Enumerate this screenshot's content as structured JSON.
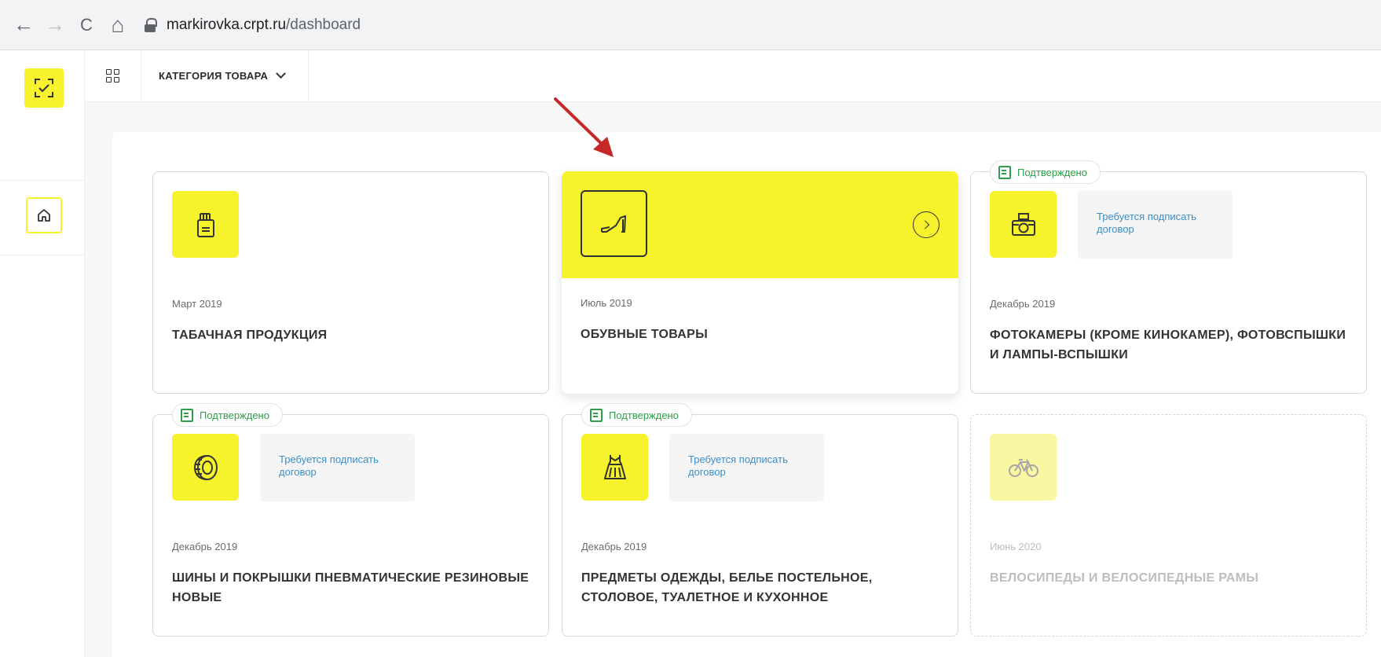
{
  "browser": {
    "url_host": "markirovka.crpt.ru",
    "url_path": "/dashboard",
    "back_glyph": "←",
    "forward_glyph": "→",
    "reload_glyph": "C",
    "home_glyph": "⌂"
  },
  "appbar": {
    "category_label": "КАТЕГОРИЯ ТОВАРА"
  },
  "colors": {
    "accent": "#f6f22b",
    "confirmed": "#2e9e4a",
    "link": "#3b8ec8",
    "arrow": "#c62828"
  },
  "cards": [
    {
      "date": "Март 2019",
      "title": "ТАБАЧНАЯ ПРОДУКЦИЯ",
      "icon": "cigarette-pack-icon"
    },
    {
      "date": "Июль 2019",
      "title": "ОБУВНЫЕ ТОВАРЫ",
      "icon": "shoe-icon",
      "highlighted": true
    },
    {
      "date": "Декабрь 2019",
      "title": "ФОТОКАМЕРЫ (КРОМЕ КИНОКАМЕР), ФОТОВСПЫШКИ И ЛАМПЫ-ВСПЫШКИ",
      "icon": "camera-icon",
      "badge": "Подтверждено",
      "sign_text": "Требуется подписать договор"
    },
    {
      "date": "Декабрь 2019",
      "title": "ШИНЫ И ПОКРЫШКИ ПНЕВМАТИЧЕСКИЕ РЕЗИНОВЫЕ НОВЫЕ",
      "icon": "tire-icon",
      "badge": "Подтверждено",
      "sign_text": "Требуется подписать договор"
    },
    {
      "date": "Декабрь 2019",
      "title": "ПРЕДМЕТЫ ОДЕЖДЫ, БЕЛЬЕ ПОСТЕЛЬНОЕ, СТОЛОВОЕ, ТУАЛЕТНОЕ И КУХОННОЕ",
      "icon": "dress-icon",
      "badge": "Подтверждено",
      "sign_text": "Требуется подписать договор"
    },
    {
      "date": "Июнь 2020",
      "title": "ВЕЛОСИПЕДЫ И ВЕЛОСИПЕДНЫЕ РАМЫ",
      "icon": "bicycle-icon",
      "disabled": true
    }
  ]
}
